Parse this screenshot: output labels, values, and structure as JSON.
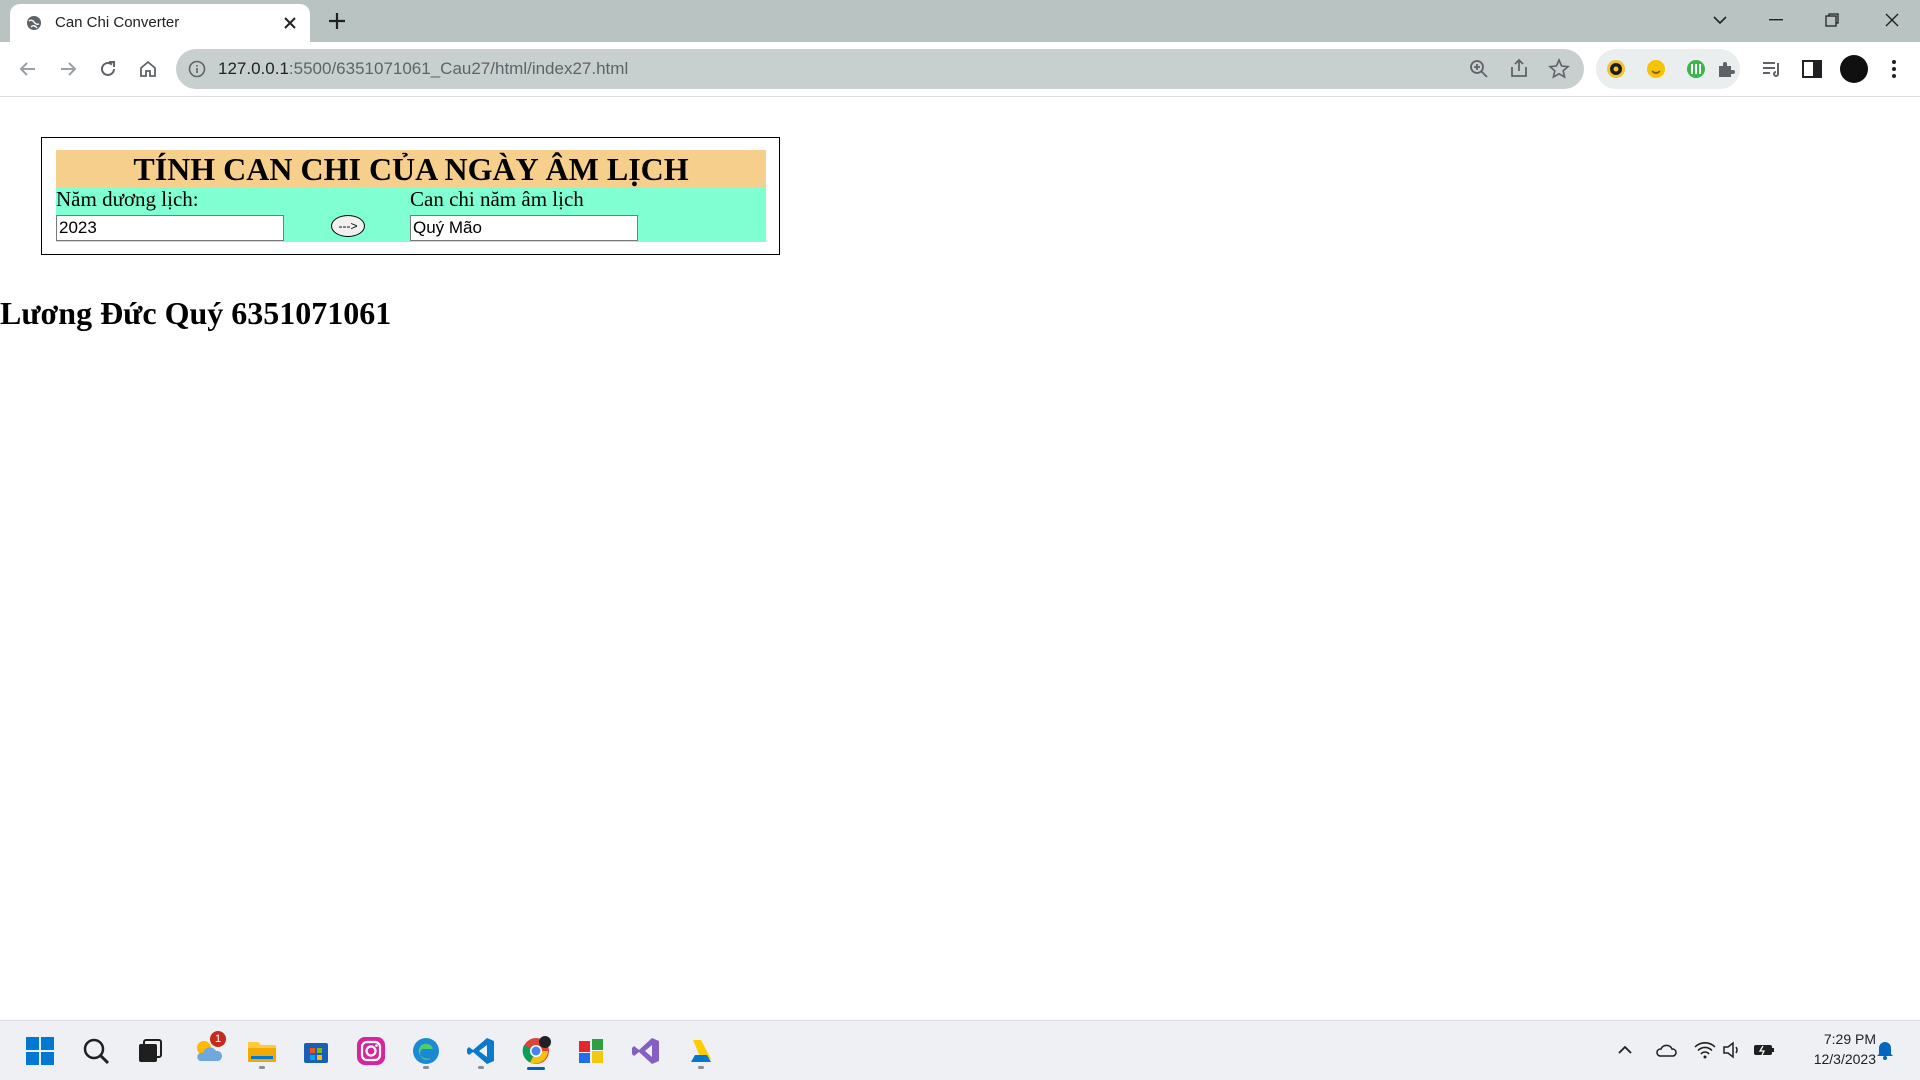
{
  "browser": {
    "tab_title": "Can Chi Converter",
    "url_host": "127.0.0.1",
    "url_rest": ":5500/6351071061_Cau27/html/index27.html"
  },
  "form": {
    "title": "TÍNH CAN CHI CỦA NGÀY ÂM LỊCH",
    "solar_label": "Năm dương lịch:",
    "solar_value": "2023",
    "convert_label": "--->",
    "lunar_label": "Can chi năm âm lịch",
    "lunar_value": "Quý Mão"
  },
  "author": "Lương Đức Quý 6351071061",
  "taskbar": {
    "weather_badge": "1",
    "time": "7:29 PM",
    "date": "12/3/2023"
  },
  "colors": {
    "title_bg": "#f6cf8d",
    "form_bg": "#80ffd3",
    "tabbar_bg": "#b9c3c2",
    "taskbar_bg": "#eef0f3"
  }
}
